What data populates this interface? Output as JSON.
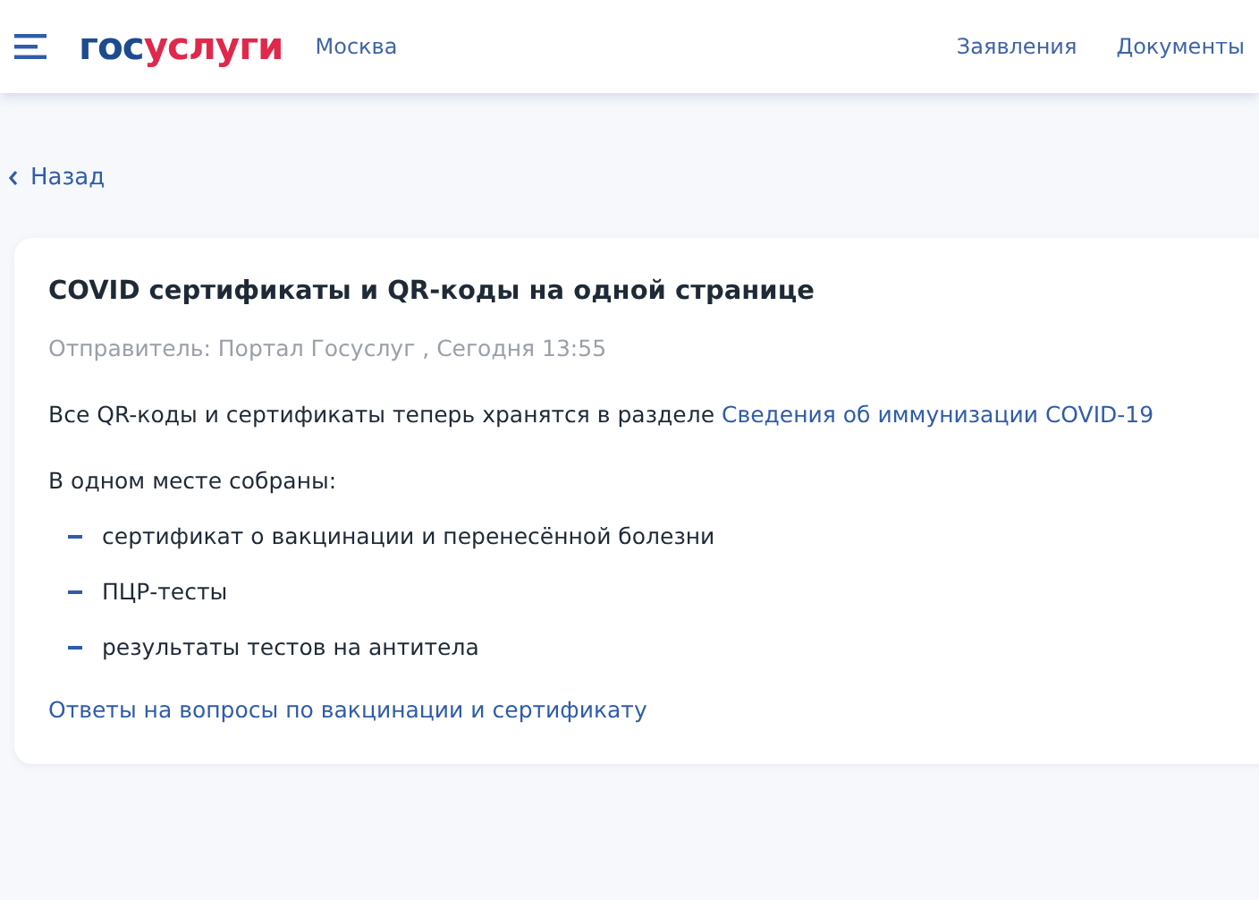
{
  "header": {
    "logo": {
      "prefix": "гос",
      "suffix": "услуги"
    },
    "city": "Москва",
    "nav": [
      "Заявления",
      "Документы"
    ]
  },
  "back": "Назад",
  "message": {
    "title": "COVID сертификаты и QR-коды на одной странице",
    "meta": "Отправитель: Портал Госуслуг , Сегодня 13:55",
    "intro": {
      "text": "Все QR-коды и сертификаты теперь хранятся в разделе",
      "link": "Сведения об иммунизации COVID-19"
    },
    "list_title": "В одном месте собраны:",
    "items": [
      "сертификат о вакцинации и перенесённой болезни",
      "ПЦР-тесты",
      "результаты тестов на антитела"
    ],
    "footer_link": "Ответы на вопросы по вакцинации и сертификату"
  }
}
